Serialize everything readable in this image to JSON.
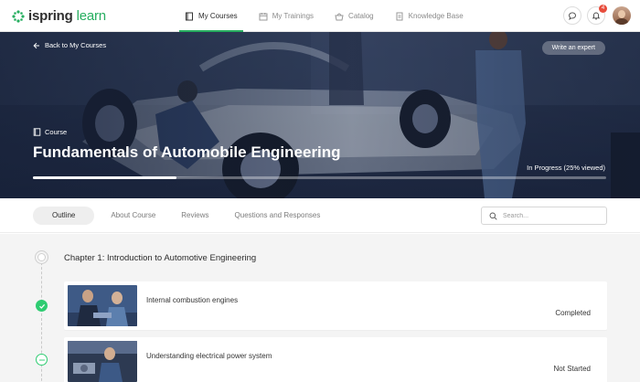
{
  "app": {
    "logo_main": "ispring",
    "logo_accent": "learn",
    "brand_color": "#27ae60"
  },
  "nav": {
    "items": [
      {
        "label": "My Courses",
        "icon": "book-icon",
        "active": true
      },
      {
        "label": "My Trainings",
        "icon": "calendar-icon",
        "active": false
      },
      {
        "label": "Catalog",
        "icon": "basket-icon",
        "active": false
      },
      {
        "label": "Knowledge Base",
        "icon": "document-icon",
        "active": false
      }
    ],
    "notification_count": "4"
  },
  "hero": {
    "back_label": "Back to My Courses",
    "expert_button": "Write an expert",
    "tag_label": "Course",
    "title": "Fundamentals of Automobile Engineering",
    "progress_text": "In Progress (25% viewed)",
    "progress_fraction": 0.25
  },
  "tabs": [
    {
      "label": "Outline",
      "active": true
    },
    {
      "label": "About Course",
      "active": false
    },
    {
      "label": "Reviews",
      "active": false
    },
    {
      "label": "Questions and Responses",
      "active": false
    }
  ],
  "search": {
    "placeholder": "Search..."
  },
  "outline": {
    "chapter_title": "Chapter 1: Introduction to Automotive Engineering",
    "lessons": [
      {
        "title": "Internal combustion engines",
        "status": "Completed"
      },
      {
        "title": "Understanding electrical power system",
        "status": "Not Started"
      }
    ]
  }
}
